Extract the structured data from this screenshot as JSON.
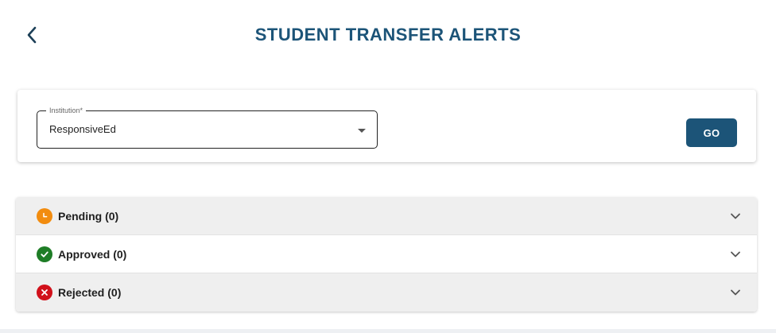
{
  "header": {
    "title": "STUDENT TRANSFER ALERTS",
    "back_icon": "chevron-left-icon"
  },
  "filter": {
    "institution_label": "Institution*",
    "institution_value": "ResponsiveEd",
    "go_label": "GO"
  },
  "alerts": [
    {
      "label": "Pending (0)",
      "icon": "clock-icon",
      "color": "#f28c0f"
    },
    {
      "label": "Approved (0)",
      "icon": "check-circle-icon",
      "color": "#1e7d26"
    },
    {
      "label": "Rejected (0)",
      "icon": "cancel-circle-icon",
      "color": "#d1111b"
    }
  ],
  "colors": {
    "brand": "#1c5478",
    "pending": "#f28c0f",
    "approved": "#1e7d26",
    "rejected": "#d1111b"
  }
}
